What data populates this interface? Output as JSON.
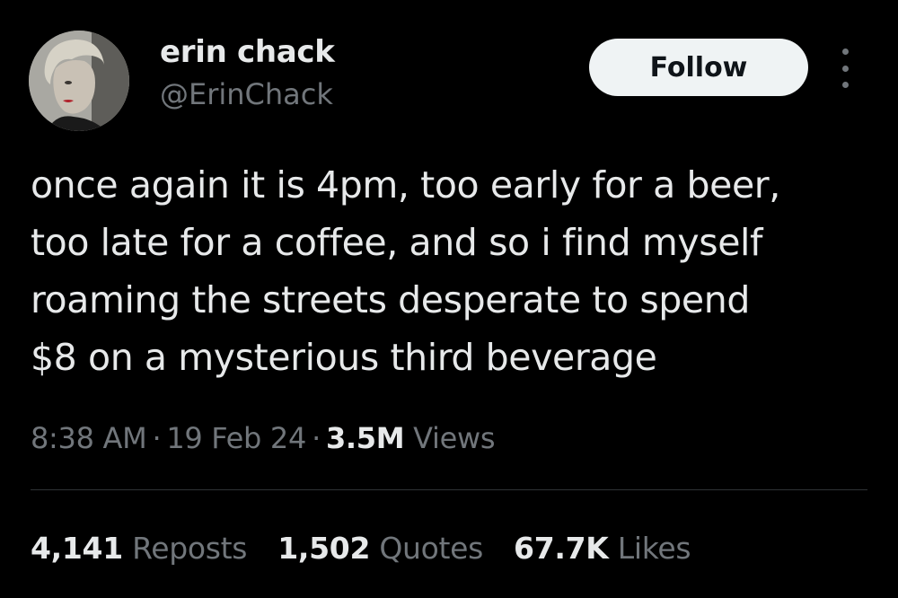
{
  "author": {
    "display_name": "erin chack",
    "handle": "@ErinChack",
    "avatar_icon": "profile-photo"
  },
  "follow_button": {
    "label": "Follow"
  },
  "more_menu": {
    "icon": "more-vertical-icon"
  },
  "tweet": {
    "lines": [
      "once again it is 4pm, too early for a beer,",
      "too late for a coffee, and so i find myself",
      "roaming the streets desperate to spend",
      "$8 on a mysterious third beverage"
    ]
  },
  "meta": {
    "time": "8:38 AM",
    "date": "19 Feb 24",
    "views_count": "3.5M",
    "views_label": "Views",
    "separator": "·"
  },
  "stats": {
    "reposts": {
      "count": "4,141",
      "label": "Reposts"
    },
    "quotes": {
      "count": "1,502",
      "label": "Quotes"
    },
    "likes": {
      "count": "67.7K",
      "label": "Likes"
    }
  },
  "colors": {
    "background": "#000000",
    "primary_text": "#e7e9ea",
    "secondary_text": "#71767b",
    "button_bg": "#eff3f4",
    "divider": "#2f3336"
  }
}
